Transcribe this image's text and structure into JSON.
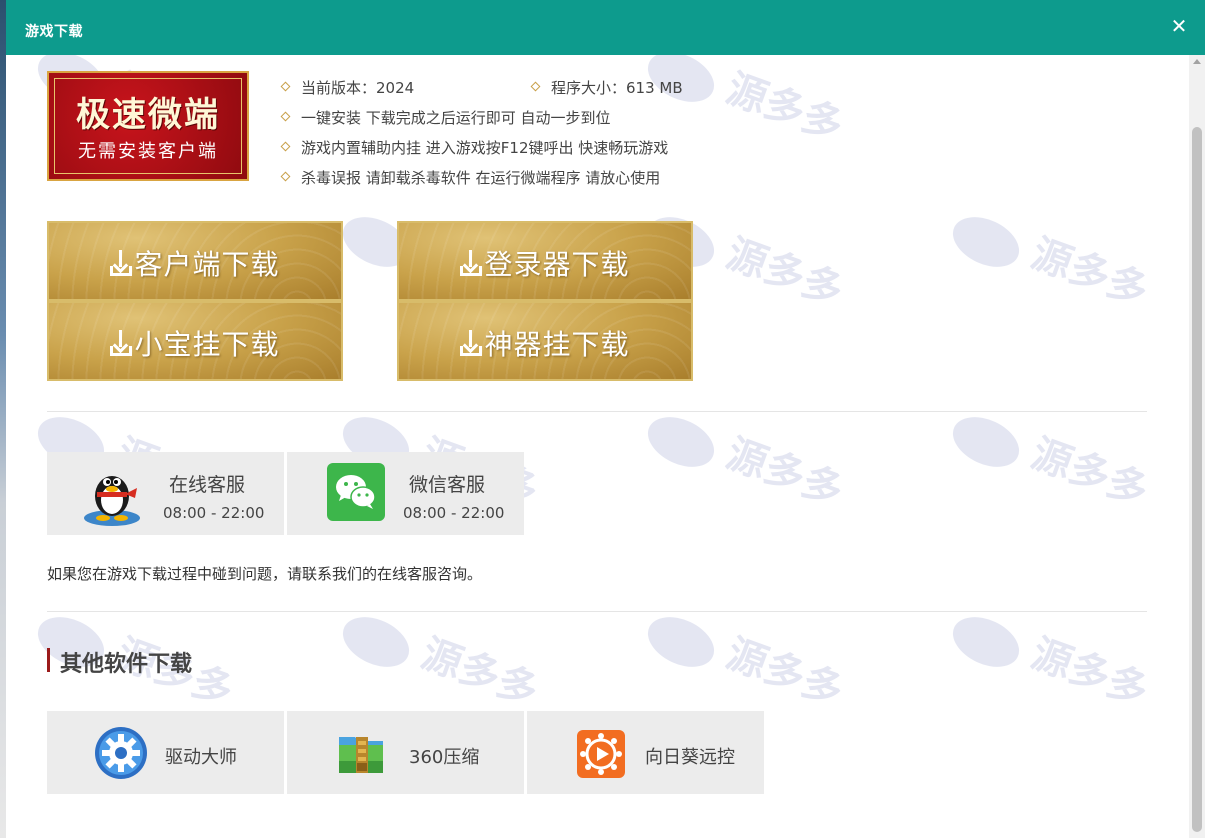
{
  "modal": {
    "title": "游戏下载",
    "close_glyph": "✕"
  },
  "logo": {
    "main": "极速微端",
    "sub": "无需安装客户端"
  },
  "info": {
    "version": "当前版本：2024",
    "size": "程序大小：613 MB",
    "line1": "一键安装 下载完成之后运行即可 自动一步到位",
    "line2": "游戏内置辅助内挂 进入游戏按F12键呼出 快速畅玩游戏",
    "line3": "杀毒误报 请卸载杀毒软件 在运行微端程序 请放心使用"
  },
  "downloads": {
    "client": "客户端下载",
    "launcher": "登录器下载",
    "xiaobao": "小宝挂下载",
    "shenqi": "神器挂下载"
  },
  "support": {
    "online_name": "在线客服",
    "online_time": "08:00 - 22:00",
    "wechat_name": "微信客服",
    "wechat_time": "08:00 - 22:00",
    "notice": "如果您在游戏下载过程中碰到问题，请联系我们的在线客服咨询。"
  },
  "other": {
    "title": "其他软件下载",
    "items": [
      {
        "label": "驱动大师",
        "icon": "driver-master-icon"
      },
      {
        "label": "360压缩",
        "icon": "360zip-icon"
      },
      {
        "label": "向日葵远控",
        "icon": "sunflower-remote-icon"
      }
    ]
  },
  "watermark": {
    "text": "源多多"
  },
  "colors": {
    "titlebar": "#0d9b8d",
    "gold_button": "#c9a24a",
    "section_accent": "#9b1b1b"
  }
}
